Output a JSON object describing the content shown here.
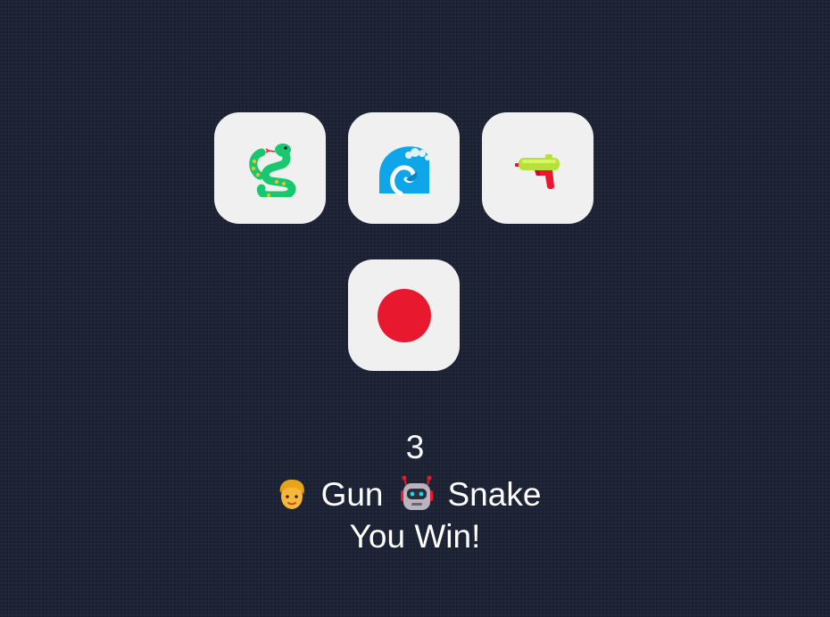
{
  "game": {
    "choices": [
      {
        "id": "snake",
        "icon": "snake-icon"
      },
      {
        "id": "water",
        "icon": "water-wave-icon"
      },
      {
        "id": "gun",
        "icon": "water-pistol-icon"
      },
      {
        "id": "stop",
        "icon": "red-circle-icon"
      }
    ],
    "score": "3",
    "player": {
      "avatar": "person-icon",
      "move": "Gun"
    },
    "computer": {
      "avatar": "robot-icon",
      "move": "Snake"
    },
    "result": "You Win!"
  },
  "colors": {
    "background": "#1c2334",
    "button": "#f0f0f0",
    "text": "#ffffff",
    "stop_red": "#e8182f"
  }
}
